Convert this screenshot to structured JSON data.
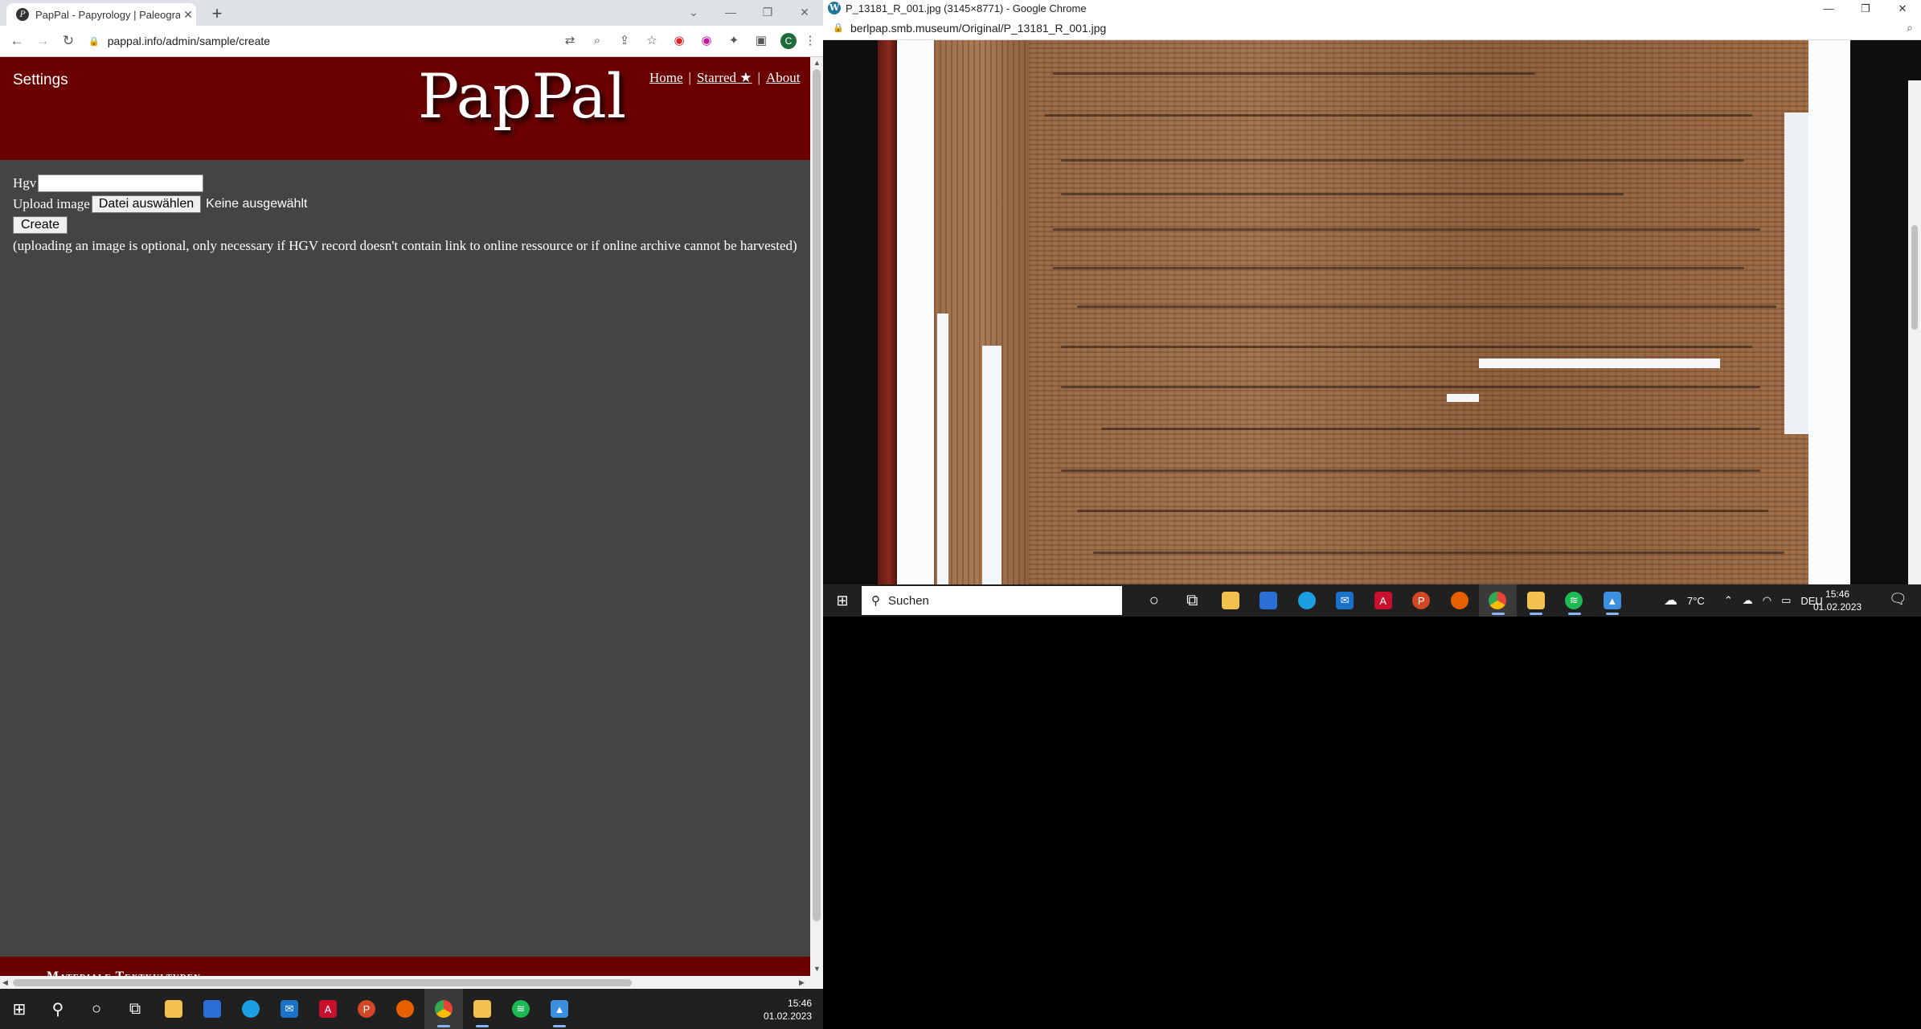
{
  "left_browser": {
    "tab_title": "PapPal - Papyrology | Paleograph",
    "tab_close": "✕",
    "new_tab": "+",
    "url": "pappal.info/admin/sample/create",
    "profile_initial": "C",
    "page": {
      "settings_label": "Settings",
      "brand": "PapPal",
      "nav": {
        "home": "Home",
        "starred": "Starred ★",
        "about": "About",
        "sep": "|"
      },
      "form": {
        "hgv_label": "Hgv",
        "hgv_value": "",
        "upload_label": "Upload image",
        "file_button": "Datei auswählen",
        "no_file": "Keine ausgewählt",
        "create_button": "Create",
        "note": "(uploading an image is optional, only necessary if HGV record doesn't contain link to online ressource or if online archive cannot be harvested)"
      },
      "footer_text": "Materiale Textkulturen"
    }
  },
  "left_taskbar": {
    "time": "15:46",
    "date": "01.02.2023"
  },
  "right_browser": {
    "title": "P_13181_R_001.jpg (3145×8771) - Google Chrome",
    "url": "berlpap.smb.museum/Original/P_13181_R_001.jpg"
  },
  "right_taskbar": {
    "search_placeholder": "Suchen",
    "weather": "7°C",
    "language": "DEU",
    "time": "15:46",
    "date": "01.02.2023"
  },
  "colors": {
    "header_red": "#6a0000",
    "page_bg": "#444444",
    "taskbar": "#202020"
  }
}
